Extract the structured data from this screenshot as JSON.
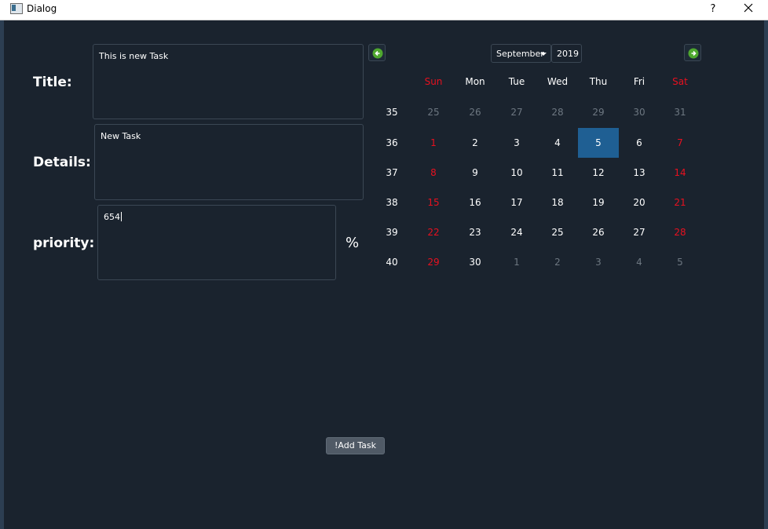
{
  "window": {
    "title": "Dialog",
    "help_label": "?",
    "close_label": "×"
  },
  "form": {
    "title_label": "Title:",
    "title_value": "This is new Task",
    "details_label": "Details:",
    "details_value": "New Task",
    "priority_label": "priority:",
    "priority_value": "654",
    "percent_symbol": "%"
  },
  "calendar": {
    "month": "September",
    "year": "2019",
    "weekdays": [
      "Sun",
      "Mon",
      "Tue",
      "Wed",
      "Thu",
      "Fri",
      "Sat"
    ],
    "weeks": [
      {
        "week": "35",
        "days": [
          "25",
          "26",
          "27",
          "28",
          "29",
          "30",
          "31"
        ]
      },
      {
        "week": "36",
        "days": [
          "1",
          "2",
          "3",
          "4",
          "5",
          "6",
          "7"
        ]
      },
      {
        "week": "37",
        "days": [
          "8",
          "9",
          "10",
          "11",
          "12",
          "13",
          "14"
        ]
      },
      {
        "week": "38",
        "days": [
          "15",
          "16",
          "17",
          "18",
          "19",
          "20",
          "21"
        ]
      },
      {
        "week": "39",
        "days": [
          "22",
          "23",
          "24",
          "25",
          "26",
          "27",
          "28"
        ]
      },
      {
        "week": "40",
        "days": [
          "29",
          "30",
          "1",
          "2",
          "3",
          "4",
          "5"
        ]
      }
    ],
    "selected_day": "5",
    "colors": {
      "weekend": "#e8101f",
      "selected": "#1f5f93",
      "dim": "#6d7781",
      "nav": "#4ea72e"
    }
  },
  "actions": {
    "add_task_label": "!Add Task"
  }
}
